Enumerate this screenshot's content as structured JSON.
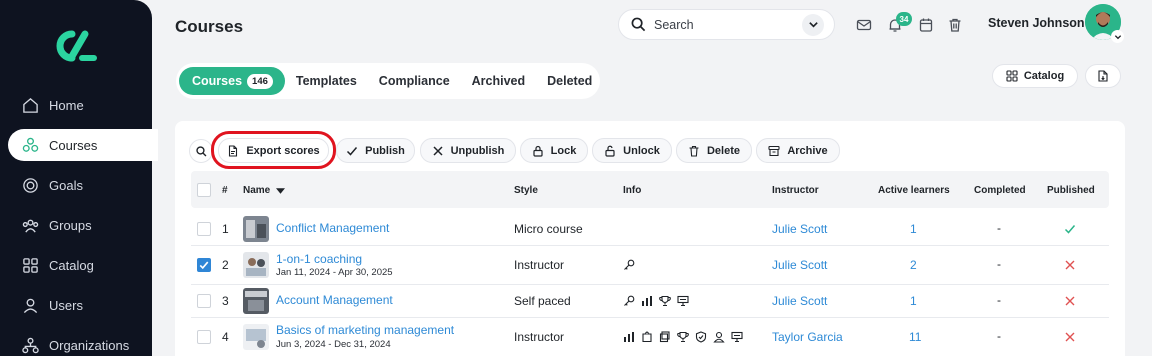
{
  "sidebar": {
    "items": [
      {
        "label": "Home",
        "icon": "home-icon",
        "active": false
      },
      {
        "label": "Courses",
        "icon": "courses-icon",
        "active": true
      },
      {
        "label": "Goals",
        "icon": "goals-icon",
        "active": false
      },
      {
        "label": "Groups",
        "icon": "groups-icon",
        "active": false
      },
      {
        "label": "Catalog",
        "icon": "catalog-icon",
        "active": false
      },
      {
        "label": "Users",
        "icon": "users-icon",
        "active": false
      },
      {
        "label": "Organizations",
        "icon": "organizations-icon",
        "active": false
      }
    ]
  },
  "header": {
    "title": "Courses",
    "search_placeholder": "Search",
    "notification_count": "34",
    "user_name": "Steven Johnson"
  },
  "tabs": [
    {
      "label": "Courses",
      "count": "146",
      "active": true
    },
    {
      "label": "Templates"
    },
    {
      "label": "Compliance"
    },
    {
      "label": "Archived"
    },
    {
      "label": "Deleted"
    }
  ],
  "top_actions": {
    "catalog_label": "Catalog"
  },
  "toolbar": {
    "export_scores": "Export scores",
    "publish": "Publish",
    "unpublish": "Unpublish",
    "lock": "Lock",
    "unlock": "Unlock",
    "delete": "Delete",
    "archive": "Archive"
  },
  "table": {
    "columns": {
      "num": "#",
      "name": "Name",
      "style": "Style",
      "info": "Info",
      "instructor": "Instructor",
      "active_learners": "Active learners",
      "completed": "Completed",
      "published": "Published"
    },
    "rows": [
      {
        "num": "1",
        "name": "Conflict Management",
        "dates": "",
        "style": "Micro course",
        "instructor": "Julie Scott",
        "active": "1",
        "completed": "-",
        "published": true,
        "checked": false
      },
      {
        "num": "2",
        "name": "1-on-1 coaching",
        "dates": "Jan 11, 2024 - Apr 30, 2025",
        "style": "Instructor",
        "instructor": "Julie Scott",
        "active": "2",
        "completed": "-",
        "published": false,
        "checked": true
      },
      {
        "num": "3",
        "name": "Account Management",
        "dates": "",
        "style": "Self paced",
        "instructor": "Julie Scott",
        "active": "1",
        "completed": "-",
        "published": false,
        "checked": false
      },
      {
        "num": "4",
        "name": "Basics of marketing management",
        "dates": "Jun 3, 2024 - Dec 31, 2024",
        "style": "Instructor",
        "instructor": "Taylor Garcia",
        "active": "11",
        "completed": "-",
        "published": false,
        "checked": false
      }
    ]
  },
  "colors": {
    "accent": "#2bb58a",
    "link": "#2e8ad6",
    "sidebar": "#0e1320",
    "highlight": "#e0141f",
    "error": "#e05252"
  }
}
